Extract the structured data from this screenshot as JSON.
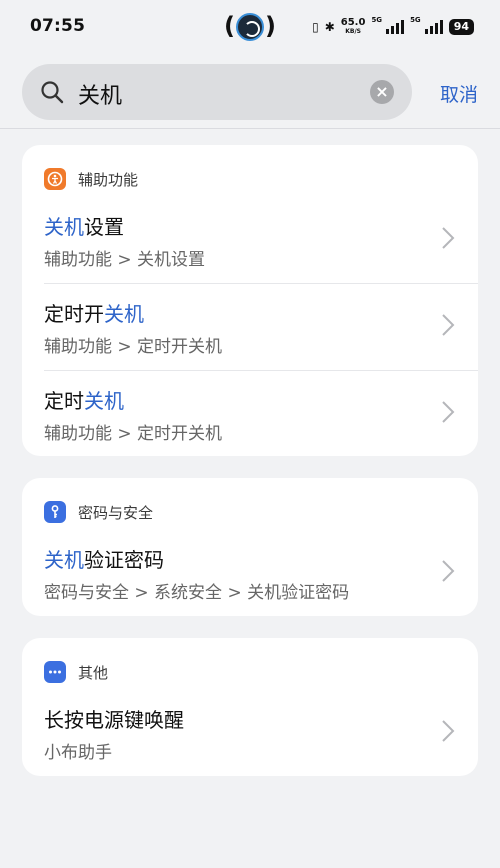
{
  "status": {
    "time": "07:55",
    "speed_value": "65.0",
    "speed_unit": "KB/S",
    "signal1_tag": "5G",
    "signal2_tag": "5G",
    "battery": "94"
  },
  "search": {
    "query": "关机",
    "cancel_label": "取消"
  },
  "colors": {
    "highlight": "#2e64c9",
    "accessibility_icon": "#f07a2b",
    "security_icon": "#3b6fe0",
    "other_icon": "#3b6fe0"
  },
  "groups": [
    {
      "category": "辅助功能",
      "icon": "accessibility-icon",
      "results": [
        {
          "title_highlight": "关机",
          "title_rest": "设置",
          "path": "辅助功能 > 关机设置"
        },
        {
          "title_prefix": "定时开",
          "title_highlight": "关机",
          "path": "辅助功能 > 定时开关机"
        },
        {
          "title_prefix": "定时",
          "title_highlight": "关机",
          "path": "辅助功能 > 定时开关机"
        }
      ]
    },
    {
      "category": "密码与安全",
      "icon": "key-icon",
      "results": [
        {
          "title_highlight": "关机",
          "title_rest": "验证密码",
          "path": "密码与安全 > 系统安全 > 关机验证密码"
        }
      ]
    },
    {
      "category": "其他",
      "icon": "more-icon",
      "results": [
        {
          "title_plain": "长按电源键唤醒",
          "path": "小布助手"
        }
      ]
    }
  ]
}
